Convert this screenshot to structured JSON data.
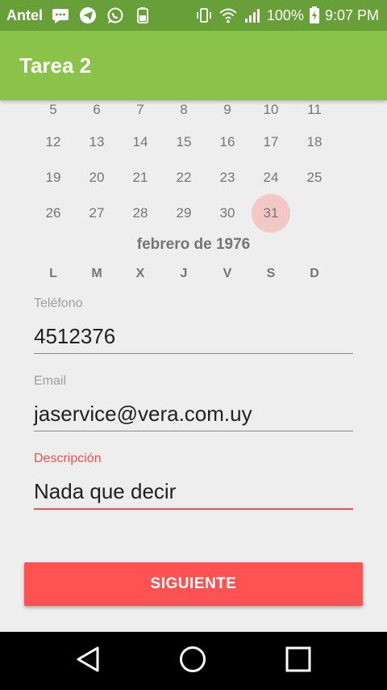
{
  "status_bar": {
    "carrier": "Antel",
    "battery": "100%",
    "time": "9:07 PM",
    "icons": [
      "message-icon",
      "telegram-icon",
      "whatsapp-icon",
      "battery-saver-icon",
      "vibrate-icon",
      "wifi-icon",
      "signal-icon",
      "battery-charging-icon"
    ]
  },
  "app_bar": {
    "title": "Tarea 2"
  },
  "calendar": {
    "top_row": [
      "5",
      "6",
      "7",
      "8",
      "9",
      "10",
      "11"
    ],
    "rows": [
      [
        "12",
        "13",
        "14",
        "15",
        "16",
        "17",
        "18"
      ],
      [
        "19",
        "20",
        "21",
        "22",
        "23",
        "24",
        "25"
      ],
      [
        "26",
        "27",
        "28",
        "29",
        "30",
        "31"
      ]
    ],
    "selected_day": "31",
    "month_title": "febrero de 1976",
    "weekdays": [
      "L",
      "M",
      "X",
      "J",
      "V",
      "S",
      "D"
    ]
  },
  "form": {
    "phone": {
      "label": "Teléfono",
      "value": "4512376"
    },
    "email": {
      "label": "Email",
      "value": "jaservice@vera.com.uy"
    },
    "description": {
      "label": "Descripción",
      "value": "Nada que decir"
    }
  },
  "actions": {
    "next_label": "SIGUIENTE"
  },
  "colors": {
    "status_bar": "#689f38",
    "app_bar": "#8bc34a",
    "accent": "#ff5252",
    "selected_day_bg": "#f4c7c7"
  },
  "nav_bar": {
    "icons": [
      "back-icon",
      "home-icon",
      "recents-icon"
    ]
  }
}
